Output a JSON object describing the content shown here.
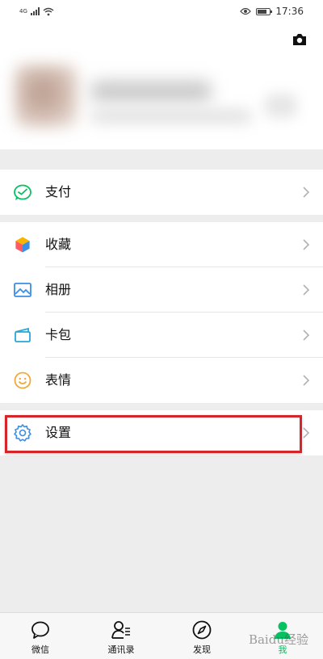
{
  "status_bar": {
    "signal": "4G",
    "time": "17:36"
  },
  "menu": {
    "pay": "支付",
    "favorites": "收藏",
    "album": "相册",
    "cards": "卡包",
    "stickers": "表情",
    "settings": "设置"
  },
  "tabs": [
    {
      "label": "微信",
      "icon": "chat-icon"
    },
    {
      "label": "通讯录",
      "icon": "contacts-icon"
    },
    {
      "label": "发现",
      "icon": "compass-icon"
    },
    {
      "label": "我",
      "icon": "me-icon",
      "active": true
    }
  ],
  "watermark": "Baidu经验",
  "colors": {
    "accent": "#07c160",
    "highlight_border": "#d6252a",
    "page_bg": "#ededed"
  }
}
